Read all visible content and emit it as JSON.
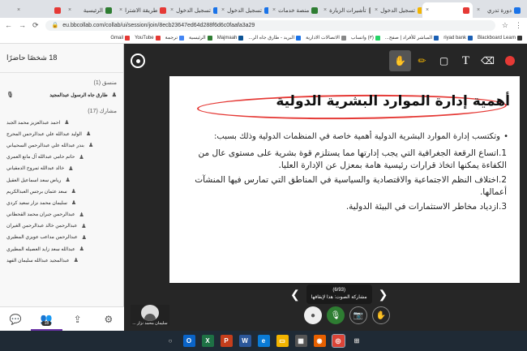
{
  "browser": {
    "tabs": [
      {
        "title": "دورة تدري",
        "active": false,
        "color": "#1a73e8"
      },
      {
        "title": "",
        "active": true,
        "color": "#e53935"
      },
      {
        "title": "تسجيل الدخول",
        "active": false,
        "color": "#f2b400"
      },
      {
        "title": "تأشيرات الزيارة",
        "active": false,
        "color": "#888888"
      },
      {
        "title": "منصة خدمات",
        "active": false,
        "color": "#2e7d32"
      },
      {
        "title": "تسجيل الدخول",
        "active": false,
        "color": "#1a73e8"
      },
      {
        "title": "تسجيل الدخول",
        "active": false,
        "color": "#1a73e8"
      },
      {
        "title": "طريقة الاشترا",
        "active": false,
        "color": "#e53935"
      },
      {
        "title": "الرئيسية",
        "active": false,
        "color": "#2e7d32"
      },
      {
        "title": "",
        "active": false,
        "color": "#e53935"
      }
    ],
    "url": "eu.bbcollab.com/collab/ui/session/join/8ecb23647ed64d288f6d6c0faafa3a29",
    "bookmarks": [
      {
        "label": "Blackboard Learn",
        "color": "#333333"
      },
      {
        "label": "riyad bank",
        "color": "#1a5fb4"
      },
      {
        "label": "المباشر للأفراد | صفح...",
        "color": "#1a5fb4"
      },
      {
        "label": "(٣) واتساب",
        "color": "#25d366"
      },
      {
        "label": "الاتصالات الادارية",
        "color": "#888888"
      },
      {
        "label": "البريد - طارق جاه الر...",
        "color": "#1a73e8"
      },
      {
        "label": "Majmaah",
        "color": "#0b5394"
      },
      {
        "label": "الرئيسية",
        "color": "#2e7d32"
      },
      {
        "label": "ترجمة",
        "color": "#4285f4"
      },
      {
        "label": "YouTube",
        "color": "#e53935"
      },
      {
        "label": "Gmail",
        "color": "#e53935"
      }
    ]
  },
  "panel": {
    "header": "18 شخصًا حاضرًا",
    "moderator_title": "منسق (1)",
    "moderator": "طارق جاه الرسول عبدالمجيد",
    "participants_title": "مشارك (17)",
    "participants": [
      "احمد عبدالعزيز محمد الجبد",
      "الوليد عبدالله علي عبدالرحمن المحرج",
      "بندر عبدالله علي عبدالرحمن السحيباني",
      "حاتم حامي عبدالله آل مانع العمري",
      "خالد عبدالله ثمروح الدمقياني",
      "رياض سعد اسماعيل العقيل",
      "سعد عثمان برجس العبدالكريم",
      "سليمان محمد نزار سعيد كردي",
      "عبدالرحمن جبران محمد القحطاني",
      "عبدالرحمن خالد عبدالرحمن الغيران",
      "عبدالرحمن مداعب عويزي المطيري",
      "عبدالله سعد زايد العصيله المطيري",
      "عبدالمجيد عبدالله سليمان الفهد"
    ],
    "badge": "18"
  },
  "slide": {
    "title": "أهمية إدارة الموارد البشرية الدولية",
    "intro": "وتكتسب إدارة الموارد البشرية الدولية أهمية خاصة في المنظمات الدولية وذلك بسبب:",
    "points": [
      "1.اتساع الرقعة الجغرافية التي يجب إدارتها مما يستلزم قوة بشرية على مستوى عال من الكفاءة يمكنها اتخاذ قرارات رئيسية هامة بمعزل عن الإدارة العليا.",
      "2.اختلاف النظم الاجتماعية والاقتصادية والسياسية في المناطق التي تمارس فيها المنشآت أعمالها.",
      "3.ازدياد مخاطر الاستثمارات في البيئة الدولية."
    ]
  },
  "pager": {
    "page": "(6/93)",
    "subtitle": "مشاركة الصوت: هذا لإيقافها"
  },
  "video": {
    "name": "سليمان محمد نزار ..."
  }
}
